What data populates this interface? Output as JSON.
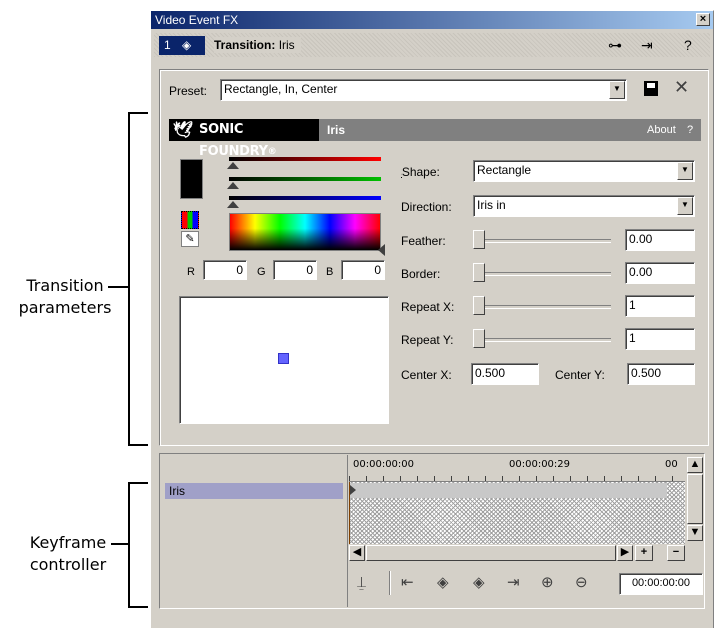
{
  "callouts": {
    "transition_parameters": [
      "Transition",
      "parameters"
    ],
    "keyframe_controller": [
      "Keyframe",
      "controller"
    ]
  },
  "window": {
    "title": "Video Event FX",
    "close": "×"
  },
  "header": {
    "chain_number": "1",
    "label": "Transition:",
    "value": "Iris",
    "icons": [
      "plugin-chain-icon",
      "remove-plugin-icon",
      "help-icon"
    ],
    "help_glyph": "?"
  },
  "preset": {
    "label": "Preset:",
    "value": "Rectangle, In, Center",
    "icons": [
      "save-icon",
      "delete-icon"
    ]
  },
  "plugin_bar": {
    "brand": "SONIC FOUNDRY",
    "registered": "®",
    "name": "Iris",
    "about": "About",
    "help": "?"
  },
  "color": {
    "rgb_labels": [
      "R",
      "G",
      "B"
    ],
    "rgb_values": [
      "0",
      "0",
      "0"
    ],
    "swatch_color": "#000000",
    "slider_colors": [
      "#ff0000",
      "#00c000",
      "#0000ff"
    ]
  },
  "params": {
    "shape": {
      "label": "Shape:",
      "value": "Rectangle",
      "access": "S"
    },
    "direction": {
      "label": "Direction:",
      "value": "Iris in",
      "access": "D"
    },
    "feather": {
      "label": "Feather:",
      "value": "0.00",
      "access": "F"
    },
    "border": {
      "label": "Border:",
      "value": "0.00",
      "access": "B"
    },
    "repeat_x": {
      "label": "Repeat X:",
      "value": "1"
    },
    "repeat_y": {
      "label": "Repeat Y:",
      "value": "1"
    },
    "center_x": {
      "label": "Center X:",
      "value": "0.500"
    },
    "center_y": {
      "label": "Center Y:",
      "value": "0.500"
    }
  },
  "preview": {
    "center_marker_color": "#6464ff"
  },
  "keyframe": {
    "track_label": "Iris",
    "ruler": [
      "00:00:00:00",
      "00:00:00:29",
      "00"
    ],
    "time": "00:00:00:00",
    "scroll_plus": "+",
    "scroll_minus": "−",
    "toolbar_icons": [
      "sync-cursor-icon",
      "first-keyframe-icon",
      "previous-keyframe-icon",
      "next-keyframe-icon",
      "last-keyframe-icon",
      "add-keyframe-icon",
      "delete-keyframe-icon"
    ]
  }
}
